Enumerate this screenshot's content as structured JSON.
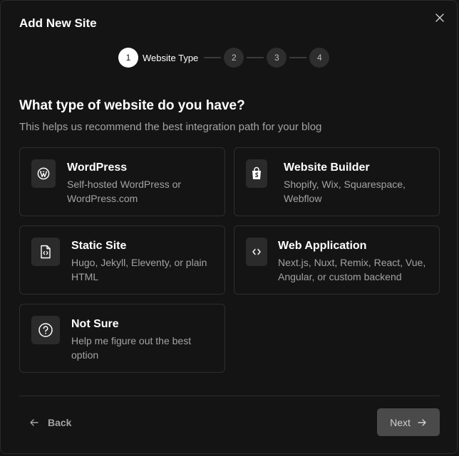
{
  "modal": {
    "title": "Add New Site",
    "close_icon": "close-icon"
  },
  "stepper": {
    "steps": [
      {
        "number": "1",
        "label": "Website Type",
        "active": true
      },
      {
        "number": "2"
      },
      {
        "number": "3"
      },
      {
        "number": "4"
      }
    ]
  },
  "question": {
    "title": "What type of website do you have?",
    "subtitle": "This helps us recommend the best integration path for your blog"
  },
  "options": [
    {
      "icon": "wordpress-icon",
      "title": "WordPress",
      "desc": "Self-hosted WordPress or WordPress.com"
    },
    {
      "icon": "shopping-bag-icon",
      "title": "Website Builder",
      "desc": "Shopify, Wix, Squarespace, Webflow"
    },
    {
      "icon": "code-file-icon",
      "title": "Static Site",
      "desc": "Hugo, Jekyll, Eleventy, or plain HTML"
    },
    {
      "icon": "code-icon",
      "title": "Web Application",
      "desc": "Next.js, Nuxt, Remix, React, Vue, Angular, or custom backend"
    },
    {
      "icon": "help-circle-icon",
      "title": "Not Sure",
      "desc": "Help me figure out the best option"
    }
  ],
  "footer": {
    "back_label": "Back",
    "next_label": "Next"
  },
  "colors": {
    "background": "#141414",
    "card_border": "#2e2e2e",
    "muted_text": "#a3a3a3",
    "next_button_bg": "#4a4a4a"
  }
}
